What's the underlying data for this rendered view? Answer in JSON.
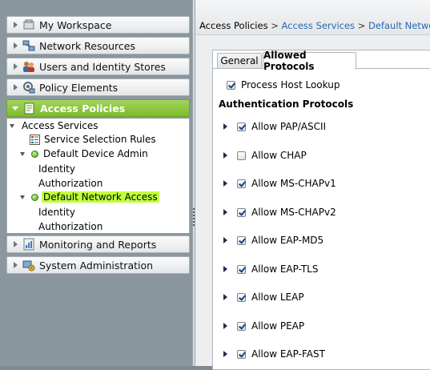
{
  "nav": {
    "items": [
      {
        "label": "My Workspace",
        "icon": "workspace-icon"
      },
      {
        "label": "Network Resources",
        "icon": "network-resources-icon"
      },
      {
        "label": "Users and Identity Stores",
        "icon": "users-icon"
      },
      {
        "label": "Policy Elements",
        "icon": "policy-elements-icon"
      },
      {
        "label": "Access Policies",
        "icon": "access-policies-icon"
      },
      {
        "label": "Monitoring and Reports",
        "icon": "monitoring-icon"
      },
      {
        "label": "System Administration",
        "icon": "system-admin-icon"
      }
    ],
    "active_index": 4,
    "tree": {
      "access_services": "Access Services",
      "service_selection_rules": "Service Selection Rules",
      "default_device_admin": "Default Device Admin",
      "dda_identity": "Identity",
      "dda_authorization": "Authorization",
      "default_network_access": "Default Network Access",
      "dna_identity": "Identity",
      "dna_authorization": "Authorization"
    }
  },
  "breadcrumb": {
    "part1": "Access Policies",
    "sep": " > ",
    "part2": "Access Services",
    "part3": "Default Network Access"
  },
  "tabs": {
    "general": "General",
    "allowed_protocols": "Allowed Protocols"
  },
  "content": {
    "process_host_lookup": {
      "label": "Process Host Lookup",
      "checked": true
    },
    "auth_heading": "Authentication Protocols",
    "protocols": [
      {
        "label": "Allow PAP/ASCII",
        "checked": true
      },
      {
        "label": "Allow CHAP",
        "checked": false
      },
      {
        "label": "Allow MS-CHAPv1",
        "checked": true
      },
      {
        "label": "Allow MS-CHAPv2",
        "checked": true
      },
      {
        "label": "Allow EAP-MD5",
        "checked": true
      },
      {
        "label": "Allow EAP-TLS",
        "checked": true
      },
      {
        "label": "Allow LEAP",
        "checked": true
      },
      {
        "label": "Allow PEAP",
        "checked": true
      },
      {
        "label": "Allow EAP-FAST",
        "checked": true
      }
    ]
  },
  "colors": {
    "active_nav": "#8cc63f",
    "selected_highlight": "#c1ff3c",
    "link": "#2769b4",
    "status_dot": "#44a415"
  }
}
